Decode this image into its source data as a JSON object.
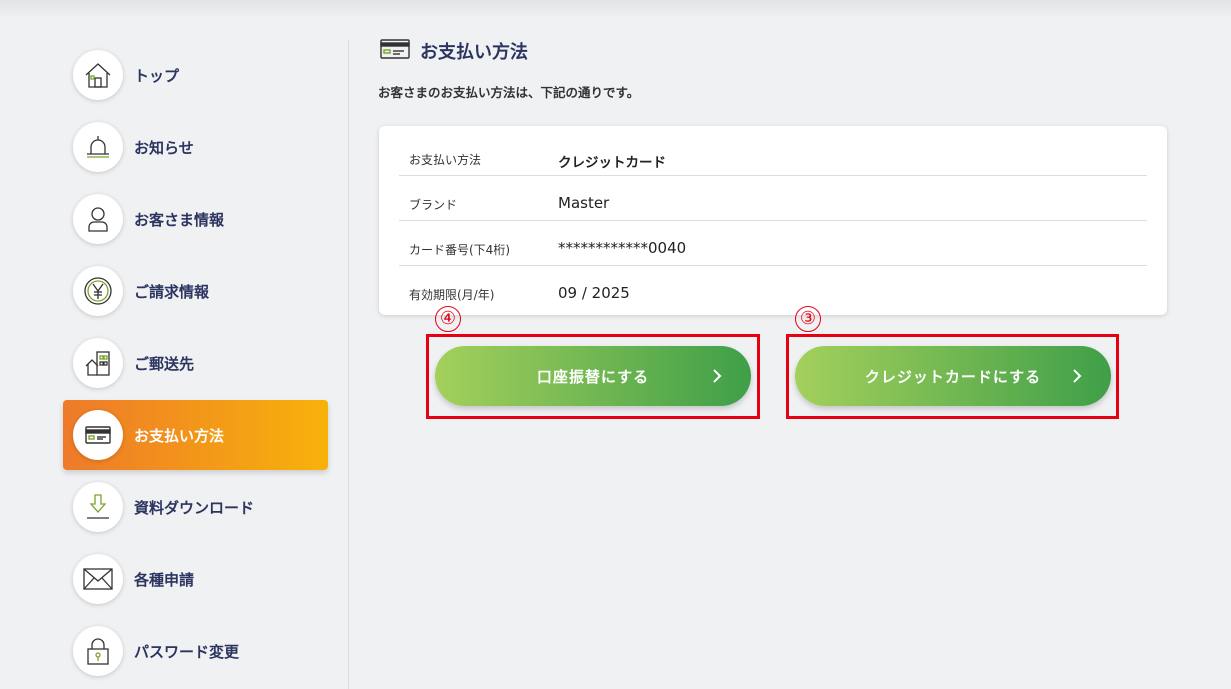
{
  "sidebar": {
    "items": [
      {
        "label": "トップ",
        "icon": "home-icon"
      },
      {
        "label": "お知らせ",
        "icon": "bell-icon"
      },
      {
        "label": "お客さま情報",
        "icon": "user-icon"
      },
      {
        "label": "ご請求情報",
        "icon": "yen-icon"
      },
      {
        "label": "ご郵送先",
        "icon": "building-icon"
      },
      {
        "label": "お支払い方法",
        "icon": "credit-card-icon",
        "active": true
      },
      {
        "label": "資料ダウンロード",
        "icon": "download-icon"
      },
      {
        "label": "各種申請",
        "icon": "envelope-icon"
      },
      {
        "label": "パスワード変更",
        "icon": "lock-icon"
      }
    ]
  },
  "main": {
    "title": "お支払い方法",
    "subtitle": "お客さまのお支払い方法は、下記の通りです。",
    "details": [
      {
        "key": "お支払い方法",
        "value": "クレジットカード"
      },
      {
        "key": "ブランド",
        "value": "Master"
      },
      {
        "key": "カード番号(下4桁)",
        "value": "************0040"
      },
      {
        "key": "有効期限(月/年)",
        "value": "09 / 2025"
      }
    ],
    "buttons": [
      {
        "label": "口座振替にする",
        "marker": "④"
      },
      {
        "label": "クレジットカードにする",
        "marker": "③"
      }
    ]
  },
  "colors": {
    "accent_orange_start": "#ee7a2a",
    "accent_orange_end": "#f7b20a",
    "button_green_start": "#a4d05c",
    "button_green_end": "#3f9f48",
    "highlight_red": "#e60012",
    "nav_text": "#2c3460"
  }
}
